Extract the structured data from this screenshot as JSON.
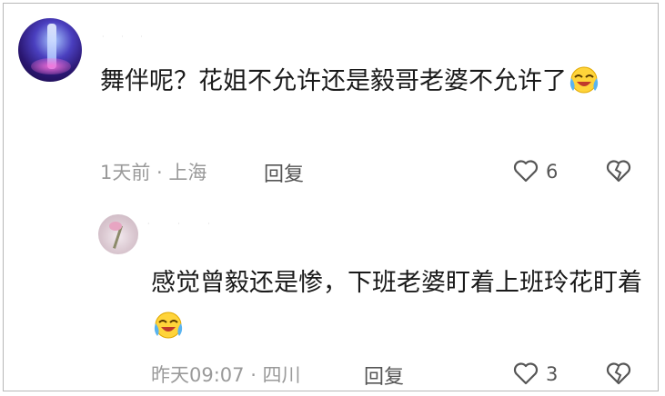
{
  "comments": [
    {
      "text": "舞伴呢？花姐不允许还是毅哥老婆不允许了",
      "emoji": "laughing-crying-emoji",
      "time_location": "1天前 · 上海",
      "reply_label": "回复",
      "like_count": "6"
    },
    {
      "text": "感觉曾毅还是惨，下班老婆盯着上班玲花盯着",
      "emoji": "laughing-crying-emoji",
      "time_location": "昨天09:07 · 四川",
      "reply_label": "回复",
      "like_count": "3"
    }
  ],
  "colors": {
    "text": "#1a1a1a",
    "meta": "#9a9a9a",
    "icon": "#555555"
  }
}
